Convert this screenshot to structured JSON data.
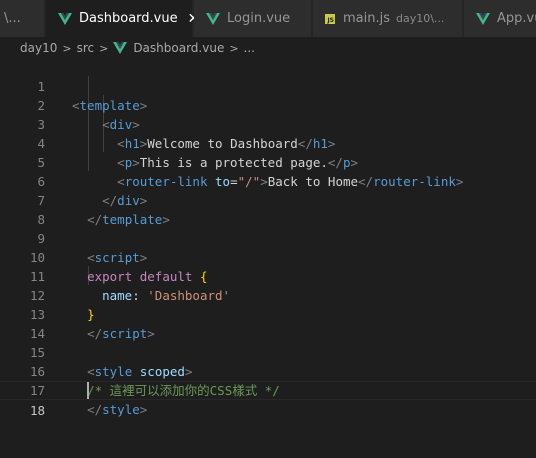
{
  "tabs": [
    {
      "label": "\\...",
      "active": false,
      "icon": "none"
    },
    {
      "label": "Dashboard.vue",
      "active": true,
      "icon": "vue-icon",
      "close": "✕"
    },
    {
      "label": "Login.vue",
      "active": false,
      "icon": "vue-icon"
    },
    {
      "label": "main.js",
      "description": "day10\\...",
      "active": false,
      "icon": "js-icon"
    },
    {
      "label": "App.vu",
      "active": false,
      "icon": "vue-icon"
    }
  ],
  "breadcrumb": {
    "items": [
      "day10",
      "src",
      "Dashboard.vue",
      "..."
    ],
    "separator": ">"
  },
  "editor": {
    "current_line": 18,
    "lines": [
      {
        "n": "1"
      },
      {
        "n": "2"
      },
      {
        "n": "3"
      },
      {
        "n": "4"
      },
      {
        "n": "5"
      },
      {
        "n": "6"
      },
      {
        "n": "7"
      },
      {
        "n": "8"
      },
      {
        "n": "9"
      },
      {
        "n": "10"
      },
      {
        "n": "11"
      },
      {
        "n": "12"
      },
      {
        "n": "13"
      },
      {
        "n": "14"
      },
      {
        "n": "15"
      },
      {
        "n": "16"
      },
      {
        "n": "17"
      },
      {
        "n": "18"
      }
    ],
    "text": {
      "template": "template",
      "div": "div",
      "h1": "h1",
      "welcome": "Welcome to Dashboard",
      "p": "p",
      "protected": "This is a protected page.",
      "router_link": "router-link",
      "to_attr": "to",
      "to_value": "\"/\"",
      "back_home": "Back to Home",
      "script": "script",
      "export_default": "export default",
      "name_key": "name",
      "name_value": "'Dashboard'",
      "style": "style",
      "scoped": "scoped",
      "comment": "/* 這裡可以添加你的CSS樣式 */"
    }
  },
  "colors": {
    "background": "#1e1e1e",
    "tag": "#569cd6",
    "attr": "#9cdcfe",
    "string": "#ce9178",
    "keyword": "#c586c0",
    "bracket": "#ffd700",
    "comment": "#6a9955",
    "vue": "#41b883"
  }
}
